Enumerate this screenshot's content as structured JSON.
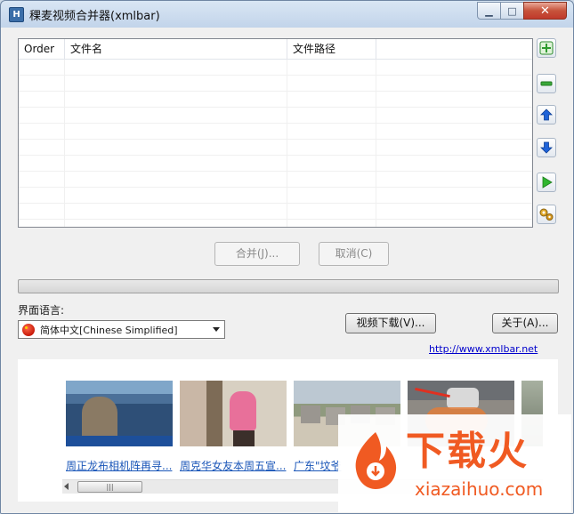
{
  "window": {
    "title": "稞麦视频合并器(xmlbar)",
    "controls": [
      "minimize",
      "maximize",
      "close"
    ]
  },
  "table": {
    "columns": [
      "Order",
      "文件名",
      "文件路径",
      ""
    ],
    "rows": []
  },
  "side_buttons": [
    {
      "name": "add-button",
      "icon": "plus-icon"
    },
    {
      "name": "remove-button",
      "icon": "minus-icon"
    },
    {
      "name": "move-up-button",
      "icon": "arrow-up-icon"
    },
    {
      "name": "move-down-button",
      "icon": "arrow-down-icon"
    },
    {
      "name": "play-button",
      "icon": "play-icon"
    },
    {
      "name": "settings-button",
      "icon": "gears-icon"
    }
  ],
  "actions": {
    "merge_label": "合并(J)...",
    "cancel_label": "取消(C)"
  },
  "progress": 0,
  "language": {
    "label": "界面语言:",
    "selected": "简体中文[Chinese Simplified]"
  },
  "buttons": {
    "download_label": "视频下载(V)...",
    "about_label": "关于(A)..."
  },
  "website": "http://www.xmlbar.net",
  "ads": [
    {
      "caption": "周正龙布相机阵再寻..."
    },
    {
      "caption": "周克华女友本周五宣..."
    },
    {
      "caption": "广东\"坟爷"
    },
    {
      "caption": ""
    },
    {
      "caption": ""
    }
  ],
  "watermark": {
    "title": "下载火",
    "subtitle": "xiazaihuo.com"
  },
  "colors": {
    "accent": "#f05a22",
    "link": "#0000cc",
    "add_green": "#3aa83a",
    "arrow_blue": "#1f63d8"
  }
}
